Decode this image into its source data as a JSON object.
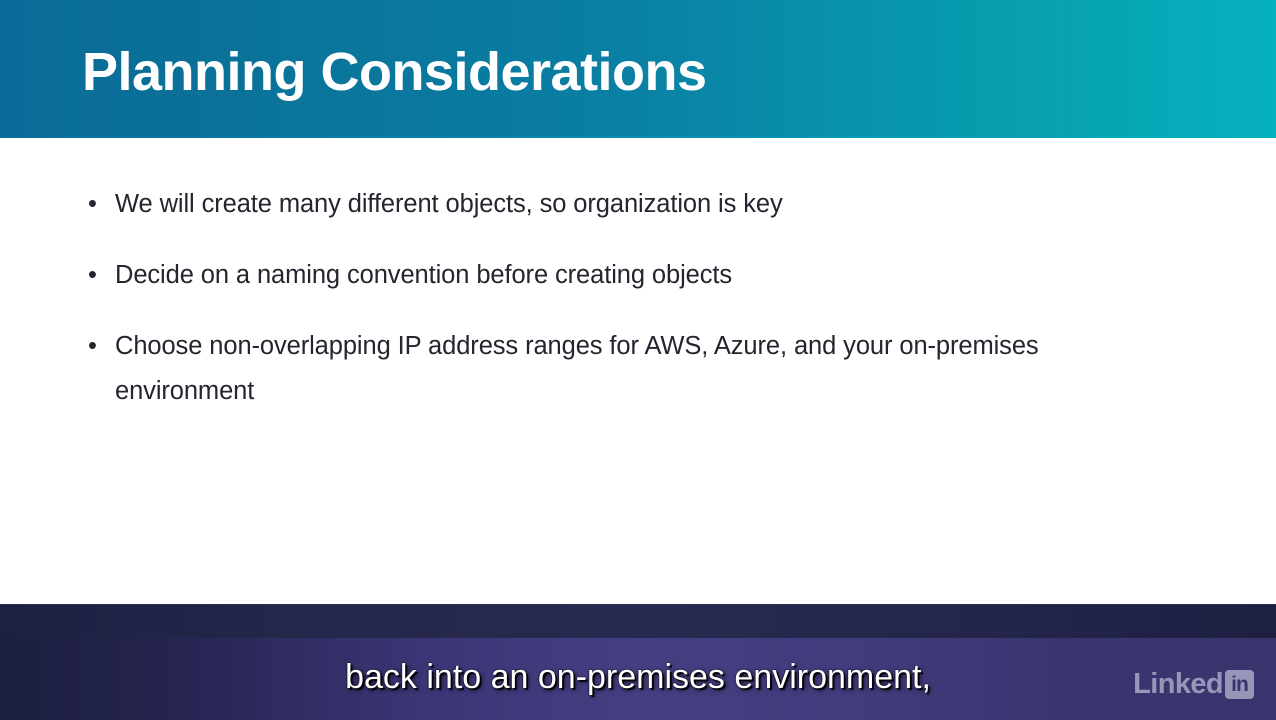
{
  "slide": {
    "title": "Planning Considerations",
    "bullet_marker": "•",
    "bullets": [
      "We will create many different objects, so organization is key",
      "Decide on a naming convention before creating objects",
      "Choose non-overlapping IP address ranges for AWS, Azure, and your on-premises environment"
    ],
    "header_gradient_start": "#0a6c9b",
    "header_gradient_end": "#05b1bd",
    "body_text_color": "#23262f",
    "background_color": "#ffffff"
  },
  "player": {
    "caption": "back into an on-premises environment,",
    "caption_color": "#ffffff",
    "bar_color": "#24274a",
    "caption_background_center": "#453e82",
    "caption_background_edge": "#1b1e3d"
  },
  "branding": {
    "wordmark": "Linked",
    "badge": "in",
    "logo_color": "#d2d4e6"
  }
}
